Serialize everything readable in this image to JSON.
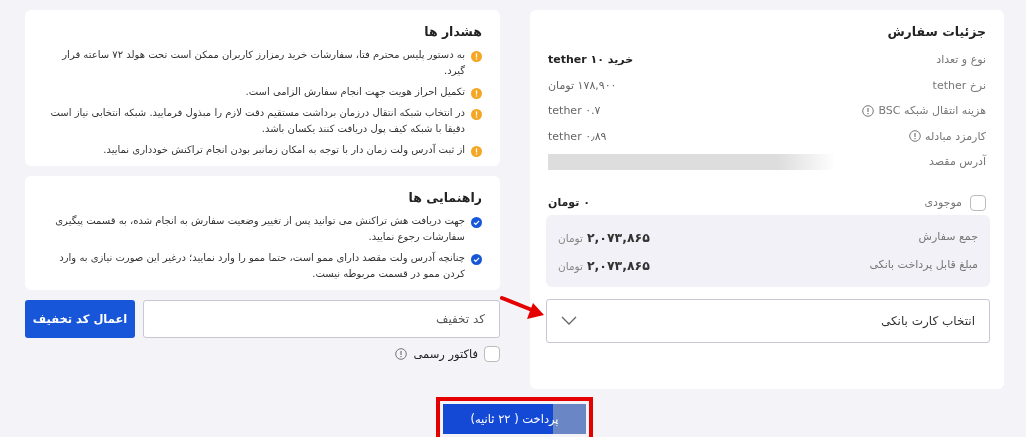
{
  "order": {
    "title": "جزئیات سفارش",
    "rows": [
      {
        "label": "نوع و تعداد",
        "value": "خرید ۱۰ tether",
        "info": false,
        "strong": true
      },
      {
        "label": "نرخ tether",
        "value": "۱۷۸,۹۰۰ تومان",
        "info": false,
        "strong": false
      },
      {
        "label": "هزینه انتقال شبکه BSC",
        "value": "tether ۰.۷",
        "info": true,
        "strong": false
      },
      {
        "label": "کارمزد مبادله",
        "value": "tether ۰٫۸۹",
        "info": true,
        "strong": false
      },
      {
        "label": "آدرس مقصد",
        "redacted": true,
        "info": false
      }
    ],
    "balance": {
      "label": "موجودی",
      "value": "۰ تومان",
      "checked": false
    },
    "totals": [
      {
        "label": "جمع سفارش",
        "amount": "۲,۰۷۳,۸۶۵",
        "unit": "تومان"
      },
      {
        "label": "مبلغ قابل پرداخت بانکی",
        "amount": "۲,۰۷۳,۸۶۵",
        "unit": "تومان"
      }
    ],
    "bank_select": {
      "placeholder": "انتخاب کارت بانکی"
    }
  },
  "warnings": {
    "title": "هشدار ها",
    "kind": "warning",
    "items": [
      "به دستور پلیس محترم فتا، سفارشات خرید رمزارز کاربران ممکن است تحت هولد ۷۲ ساعته قرار گیرد.",
      "تکمیل احراز هویت جهت انجام سفارش الزامی است.",
      "در انتخاب شبکه انتقال درزمان برداشت مستقیم دقت لازم را مبذول فرمایید. شبکه انتخابی نیاز است دقیقا با شبکه کیف پول دریافت کنند یکسان باشد.",
      "از ثبت آدرس ولت زمان دار با توجه به امکان زمانبر بودن انجام تراکنش خودداری نمایید."
    ]
  },
  "guides": {
    "title": "راهنمایی ها",
    "kind": "check",
    "items": [
      "جهت دریافت هش تراکنش می توانید پس از تغییر وضعیت سفارش به انجام شده، به قسمت پیگیری سفارشات رجوع نمایید.",
      "چنانچه آدرس ولت مقصد دارای ممو است، حتما ممو را وارد نمایید؛ درغیر این صورت نیازی به وارد کردن ممو در قسمت مربوطه نیست."
    ]
  },
  "discount": {
    "placeholder": "کد تخفیف",
    "button": "اعمال کد تخفیف"
  },
  "invoice": {
    "label": "فاکتور رسمی",
    "checked": false
  },
  "pay": {
    "label": "پرداخت ( ۲۲ ثانیه)",
    "level": 0.77
  }
}
